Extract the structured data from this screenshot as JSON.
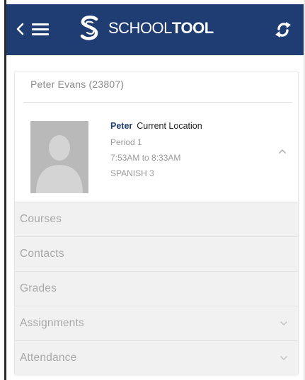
{
  "app": {
    "brand_prefix": "SCHOOL",
    "brand_suffix": "TOOL"
  },
  "student": {
    "header": "Peter Evans (23807)",
    "first_name": "Peter",
    "location_label": "Current Location",
    "period": "Period 1",
    "time": "7:53AM to 8:33AM",
    "course": "SPANISH 3"
  },
  "sections": [
    {
      "label": "Courses"
    },
    {
      "label": "Contacts"
    },
    {
      "label": "Grades"
    },
    {
      "label": "Assignments"
    },
    {
      "label": "Attendance"
    }
  ],
  "icons": {
    "back": "chevron-left-icon",
    "menu": "hamburger-menu-icon",
    "logo": "schooltool-s-logo",
    "sync": "sync-icon",
    "photo": "avatar-placeholder",
    "expand": "chevron-up-icon",
    "collapse": "chevron-down-icon"
  },
  "colors": {
    "header_bg": "#1f3d73",
    "accent": "#1f3d73",
    "section_bg": "#f1f1f1",
    "muted_text": "#a8a8a8"
  }
}
